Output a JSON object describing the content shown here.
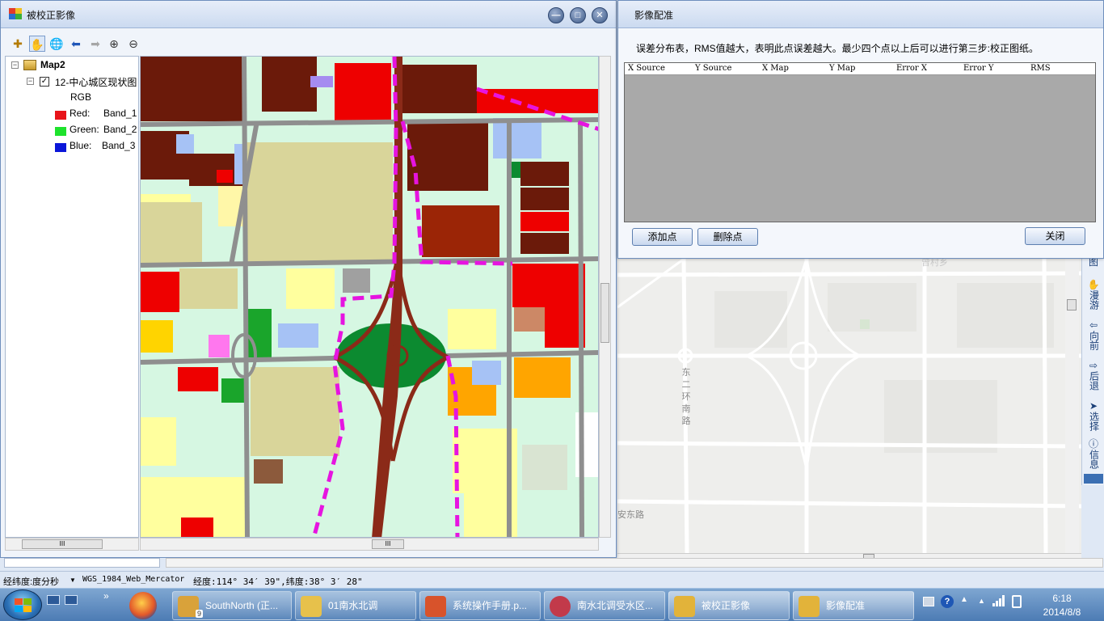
{
  "left_window": {
    "title": "被校正影像",
    "buttons": {
      "minimize": "—",
      "maximize": "□",
      "close": "✕"
    },
    "toolbar": [
      {
        "name": "add-data-icon",
        "glyph": "✚"
      },
      {
        "name": "pan-icon",
        "glyph": "✋"
      },
      {
        "name": "full-extent-icon",
        "glyph": "🌐"
      },
      {
        "name": "back-arrow-icon",
        "glyph": "⬅"
      },
      {
        "name": "forward-arrow-icon",
        "glyph": "➡"
      },
      {
        "name": "zoom-in-icon",
        "glyph": "⊕"
      },
      {
        "name": "zoom-out-icon",
        "glyph": "⊖"
      }
    ],
    "toc": {
      "map_name": "Map2",
      "layer_name": "12-中心城区现状图",
      "rgb_label": "RGB",
      "bands": [
        {
          "channel": "Red:",
          "band": "Band_1",
          "color": "#e8141a"
        },
        {
          "channel": "Green:",
          "band": "Band_2",
          "color": "#1ee22c"
        },
        {
          "channel": "Blue:",
          "band": "Band_3",
          "color": "#0b16d9"
        }
      ]
    },
    "scroll_grip": "III"
  },
  "dialog": {
    "title": "影像配准",
    "instruction": "误差分布表，RMS值越大，表明此点误差越大。最少四个点以上后可以进行第三步:校正图纸。",
    "columns": [
      "X Source",
      "Y Source",
      "X Map",
      "Y Map",
      "Error X",
      "Error Y",
      "RMS"
    ],
    "add_button": "添加点",
    "delete_button": "删除点",
    "close_button": "关闭"
  },
  "basemap": {
    "labels": {
      "village": "曾村乡",
      "road_vertical": "东二环南路",
      "road_horizontal": "安东路"
    }
  },
  "right_tools": [
    {
      "name": "map-tool",
      "icon": "",
      "label": "图"
    },
    {
      "name": "pan-tool",
      "icon": "✋",
      "label": "漫游"
    },
    {
      "name": "forward-tool",
      "icon": "⇦",
      "label": "向前"
    },
    {
      "name": "back-tool",
      "icon": "⇨",
      "label": "后退"
    },
    {
      "name": "select-tool",
      "icon": "➤",
      "label": "选择"
    },
    {
      "name": "info-tool",
      "icon": "ⓘ",
      "label": "信息"
    }
  ],
  "statusbar": {
    "unit": "经纬度:度分秒",
    "projection": "WGS_1984_Web_Mercator",
    "coordinates": "经度:114° 34′ 39\",纬度:38° 3′ 28\""
  },
  "taskbar": {
    "items": [
      {
        "label": "SouthNorth (正...",
        "badge": "9",
        "color": "#d9a23a"
      },
      {
        "label": "01南水北调",
        "color": "#e7c14b"
      },
      {
        "label": "系统操作手册.p...",
        "color": "#d8532b"
      },
      {
        "label": "南水北调受水区...",
        "color": "#c23a4a"
      },
      {
        "label": "被校正影像",
        "color": "#e2b33a"
      },
      {
        "label": "影像配准",
        "color": "#e2b33a"
      }
    ],
    "time": "6:18",
    "date": "2014/8/8"
  }
}
